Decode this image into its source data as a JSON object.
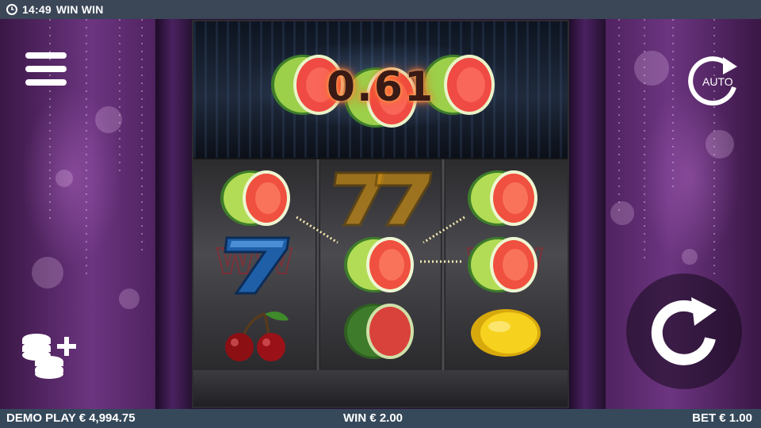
{
  "status_bar": {
    "time": "14:49",
    "app_title": "WIN WIN"
  },
  "win_display": {
    "amount": "0.61"
  },
  "buttons": {
    "auto_label": "AUTO"
  },
  "bottom_bar": {
    "balance_text": "DEMO PLAY € 4,994.75",
    "win_text": "WIN € 2.00",
    "bet_text": "BET € 1.00"
  },
  "reels": [
    [
      "watermelon-slice",
      "seven",
      "cherries"
    ],
    [
      "seven",
      "watermelon-slice",
      "watermelon-slice"
    ],
    [
      "watermelon-slice",
      "watermelon-slice",
      "lemon"
    ]
  ],
  "icons": {
    "menu": "hamburger-menu-icon",
    "coins": "coin-stack-plus-icon",
    "auto": "auto-spin-icon",
    "spin": "spin-arrow-icon",
    "clock": "clock-icon"
  },
  "colors": {
    "status_bar": "#3b4657",
    "bottom_bar": "#36495b",
    "curtain_purple": "#6c3580",
    "win_glow": "#ff8a3a"
  }
}
